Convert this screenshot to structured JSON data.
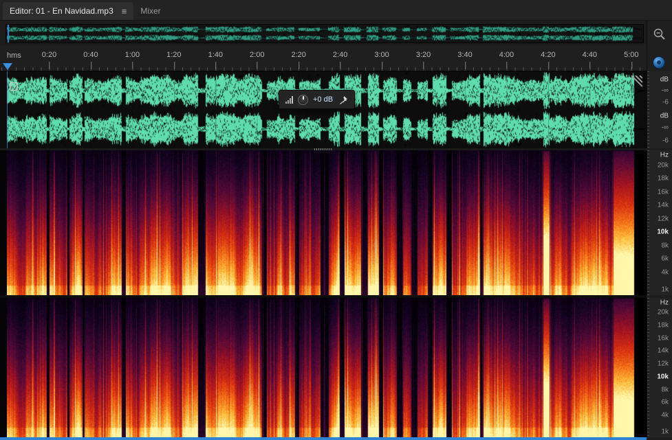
{
  "colors": {
    "accent_blue": "#2e83d4",
    "waveform_green": "#5fdcae",
    "overview_teal": "#2f9a80",
    "hud_value_blue": "#cfe6ff"
  },
  "tabs": {
    "editor_label": "Editor: 01 - En Navidad.mp3",
    "panel_menu_icon": "≡",
    "mixer_label": "Mixer"
  },
  "ruler": {
    "unit_label": "hms",
    "time_labels": [
      "0:20",
      "0:40",
      "1:00",
      "1:20",
      "1:40",
      "2:00",
      "2:20",
      "2:40",
      "3:00",
      "3:20",
      "3:40",
      "4:00",
      "4:20",
      "4:40",
      "5:00"
    ]
  },
  "hud": {
    "gain_value": "+0 dB"
  },
  "amplitude_scale": {
    "channel1": {
      "unit": "dB",
      "ticks": [
        "-∞",
        "-6"
      ]
    },
    "channel2": {
      "unit": "dB",
      "ticks": [
        "-∞",
        "-6"
      ]
    }
  },
  "frequency_scale": {
    "unit": "Hz",
    "labels": [
      "20k",
      "18k",
      "16k",
      "14k",
      "12k",
      "10k",
      "8k",
      "6k",
      "4k",
      "1k"
    ]
  }
}
